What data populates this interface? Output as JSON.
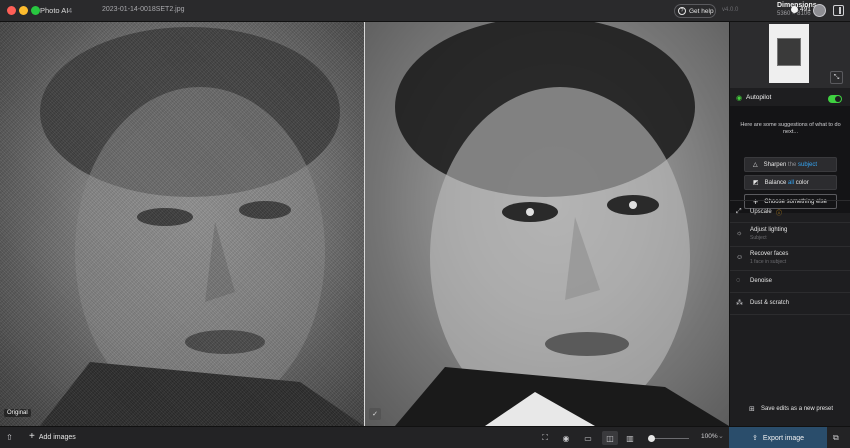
{
  "titlebar": {
    "app_name": "Photo AI",
    "app_version": "4",
    "file_name": "2023-01-14-0018SET2.jpg",
    "help_label": "Get help",
    "version": "v4.0.0",
    "dimensions_label": "Dimensions",
    "dimensions_value": "5360 × 8106",
    "credits": "491"
  },
  "canvas": {
    "original_label": "Original"
  },
  "bottombar": {
    "add_images_label": "Add images",
    "zoom_value": "100%",
    "zoom_slider_fraction": 0.05,
    "export_label": "Export image"
  },
  "panel": {
    "autopilot_label": "Autopilot",
    "autopilot_on": true,
    "suggest_text": "Here are some suggestions of what to do next...",
    "suggestions": [
      {
        "prefix": "Sharpen",
        "middle": "the",
        "highlight": "subject",
        "suffix": ""
      },
      {
        "prefix": "Balance",
        "middle": "",
        "highlight": "all",
        "suffix": "color"
      }
    ],
    "choose_label": "Choose something else",
    "tools": [
      {
        "name": "Upscale",
        "sub": "",
        "icon": "upscale-icon"
      },
      {
        "name": "Adjust lighting",
        "sub": "Subject",
        "icon": "lighting-icon"
      },
      {
        "name": "Recover faces",
        "sub": "1 face in subject",
        "icon": "face-icon"
      },
      {
        "name": "Denoise",
        "sub": "",
        "icon": "denoise-icon"
      },
      {
        "name": "Dust & scratch",
        "sub": "",
        "icon": "dust-icon"
      }
    ],
    "preset_label": "Save edits as a new preset"
  },
  "colors": {
    "accent_green": "#3fd141",
    "highlight_blue": "#35a6f5",
    "export_blue": "#2a4d6b",
    "warning": "#f2a91c"
  }
}
